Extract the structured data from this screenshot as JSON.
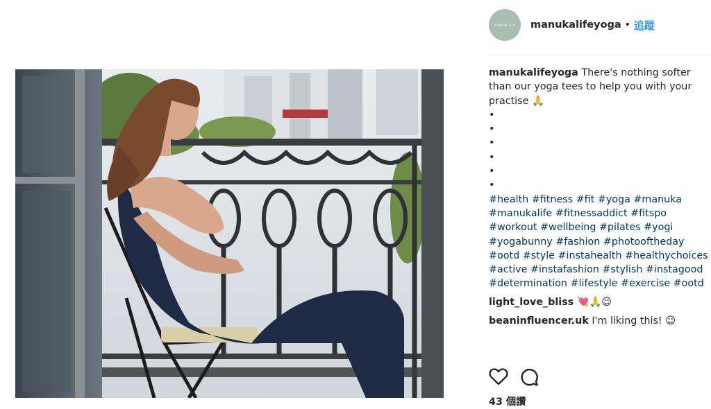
{
  "post": {
    "username": "manukalifeyoga",
    "avatar_text": "MANUKA LIFE",
    "follow_label": "追蹤",
    "separator": "•",
    "caption_text": "There's nothing softer than our yoga tees to help you with your practise 🙏",
    "bullet": "•",
    "hashtags": [
      "#health",
      "#fitness",
      "#fit",
      "#yoga",
      "#manuka",
      "#manukalife",
      "#fitnessaddict",
      "#fitspo",
      "#workout",
      "#wellbeing",
      "#pilates",
      "#yogi",
      "#yogabunny",
      "#fashion",
      "#photooftheday",
      "#ootd",
      "#style",
      "#instahealth",
      "#healthychoices",
      "#active",
      "#instafashion",
      "#stylish",
      "#instagood",
      "#determination",
      "#lifestyle",
      "#exercise",
      "#ootd"
    ],
    "comments": [
      {
        "username": "light_love_bliss",
        "text": "💘🙏☺"
      },
      {
        "username": "beaninfluencer.uk",
        "text": "I'm liking this! ☺"
      }
    ],
    "likes_label": "43 個讚"
  },
  "icons": {
    "like": "heart-icon",
    "comment": "comment-bubble-icon"
  },
  "colors": {
    "link": "#003569",
    "follow": "#3897f0",
    "text": "#262626",
    "avatar": "#a9bdb0"
  }
}
